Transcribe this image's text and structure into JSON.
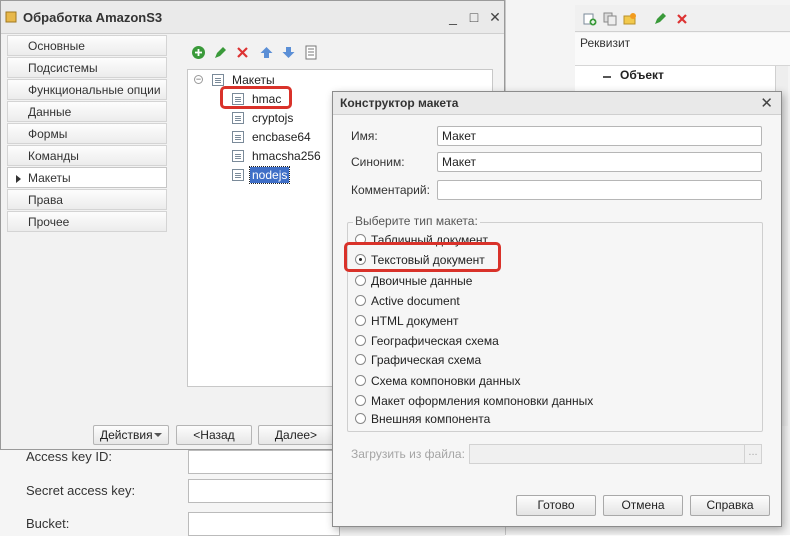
{
  "right_panel": {
    "column_header": "Реквизит",
    "row_label": "Объект"
  },
  "background_form": {
    "access_key_label": "Access key ID:",
    "secret_key_label": "Secret access key:",
    "bucket_label": "Bucket:"
  },
  "main_window": {
    "title": "Обработка AmazonS3",
    "sidebar": {
      "items": [
        {
          "label": "Основные"
        },
        {
          "label": "Подсистемы"
        },
        {
          "label": "Функциональные опции"
        },
        {
          "label": "Данные"
        },
        {
          "label": "Формы"
        },
        {
          "label": "Команды"
        },
        {
          "label": "Макеты"
        },
        {
          "label": "Права"
        },
        {
          "label": "Прочее"
        }
      ],
      "active": "Макеты"
    },
    "tree": {
      "root": "Макеты",
      "items": [
        "hmac",
        "cryptojs",
        "encbase64",
        "hmacsha256",
        "nodejs"
      ],
      "selected": "nodejs"
    },
    "buttons": {
      "actions": "Действия",
      "back": "<Назад",
      "next": "Далее>"
    }
  },
  "dialog": {
    "title": "Конструктор макета",
    "name_label": "Имя:",
    "name_value": "Макет",
    "synonym_label": "Синоним:",
    "synonym_value": "Макет",
    "comment_label": "Комментарий:",
    "comment_value": "",
    "group_label": "Выберите тип макета:",
    "options": [
      "Табличный документ",
      "Текстовый документ",
      "Двоичные данные",
      "Active document",
      "HTML документ",
      "Географическая схема",
      "Графическая схема",
      "Схема компоновки данных",
      "Макет оформления компоновки данных",
      "Внешняя компонента"
    ],
    "selected_option": "Текстовый документ",
    "load_label": "Загрузить из файла:",
    "load_button": "...",
    "ok": "Готово",
    "cancel": "Отмена",
    "help": "Справка"
  },
  "colors": {
    "highlight": "#d9322a",
    "selection": "#3f6fc7"
  }
}
